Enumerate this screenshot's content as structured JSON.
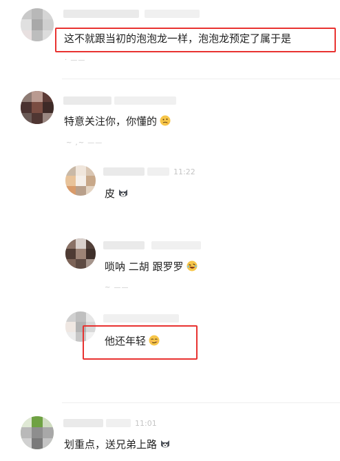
{
  "comments": [
    {
      "id": "c1",
      "text": "这不就跟当初的泡泡龙一样，泡泡龙预定了属于是",
      "highlighted": true
    },
    {
      "id": "c2",
      "text": "特意关注你，你懂的",
      "emoji": "thinking-emoji"
    },
    {
      "id": "r1",
      "text": "皮",
      "emoji": "husky-dog-emoji",
      "meta": "11:22"
    },
    {
      "id": "r2",
      "text": "唢呐 二胡 跟罗罗",
      "emoji": "rolling-laugh-emoji"
    },
    {
      "id": "r3",
      "text": "他还年轻",
      "emoji": "smirk-emoji",
      "highlighted": true
    },
    {
      "id": "c3",
      "text": "划重点，送兄弟上路",
      "emoji": "husky-dog-emoji",
      "meta": "11:01"
    }
  ],
  "colors": {
    "highlight": "#e8312f",
    "divider": "#eeeeee"
  }
}
